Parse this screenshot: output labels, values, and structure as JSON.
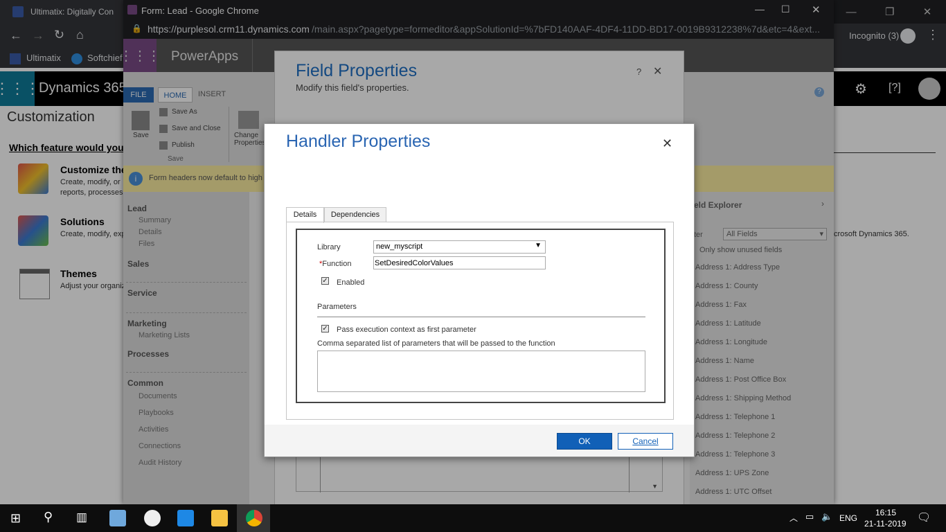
{
  "bg_browser": {
    "tab_title": "Ultimatix: Digitally Con",
    "bookmarks": [
      "Ultimatix",
      "Softchief"
    ],
    "incognito_label": "Incognito (3)"
  },
  "bg_dynamics": {
    "app_title": "Dynamics 365",
    "page_heading": "Customization",
    "which_feature": "Which feature would you",
    "items": [
      {
        "title": "Customize the",
        "desc1": "Create, modify, or",
        "desc2": "reports, processes,"
      },
      {
        "title": "Solutions",
        "desc1": "Create, modify, exp",
        "desc2": ""
      },
      {
        "title": "Themes",
        "desc1": "Adjust your organiz",
        "desc2": ""
      }
    ],
    "right_text": "crosoft Dynamics 365."
  },
  "popup": {
    "window_title": "Form: Lead - Google Chrome",
    "url_host": "https://purplesol.crm11.dynamics.com",
    "url_path": "/main.aspx?pagetype=formeditor&appSolutionId=%7bFD140AAF-4DF4-11DD-BD17-0019B9312238%7d&etc=4&ext...",
    "app_name": "PowerApps",
    "ribbon_tabs": [
      "FILE",
      "HOME",
      "INSERT"
    ],
    "ribbon": {
      "save": "Save",
      "save_as": "Save As",
      "save_close": "Save and Close",
      "publish": "Publish",
      "group_save": "Save",
      "change_props": "Change Properties"
    },
    "info_bar": "Form headers now default to high",
    "nav": {
      "lead": "Lead",
      "lead_items": [
        "Summary",
        "Details",
        "Files"
      ],
      "sections": [
        "Sales",
        "Service",
        "Marketing",
        "Processes",
        "Common"
      ],
      "marketing_items": [
        "Marketing Lists"
      ],
      "common_items": [
        "Documents",
        "Playbooks",
        "Activities",
        "Connections",
        "Audit History"
      ]
    },
    "field_explorer": {
      "title": "eld Explorer",
      "filter_label": "ter",
      "filter_value": "All Fields",
      "only_unused": "Only show unused fields",
      "fields": [
        "Address 1: Address Type",
        "Address 1: County",
        "Address 1: Fax",
        "Address 1: Latitude",
        "Address 1: Longitude",
        "Address 1: Name",
        "Address 1: Post Office Box",
        "Address 1: Shipping Method",
        "Address 1: Telephone 1",
        "Address 1: Telephone 2",
        "Address 1: Telephone 3",
        "Address 1: UPS Zone",
        "Address 1: UTC Offset"
      ]
    }
  },
  "field_properties": {
    "title": "Field Properties",
    "subtitle": "Modify this field's properties."
  },
  "handler": {
    "title": "Handler Properties",
    "tabs": [
      "Details",
      "Dependencies"
    ],
    "library_label": "Library",
    "library_value": "new_myscript",
    "function_label": "Function",
    "function_value": "SetDesiredColorValues",
    "enabled_label": "Enabled",
    "parameters_heading": "Parameters",
    "pass_context_label": "Pass execution context as first parameter",
    "comma_label": "Comma separated list of parameters that will be passed to the function",
    "params_value": "",
    "ok": "OK",
    "cancel": "Cancel"
  },
  "taskbar": {
    "language": "ENG",
    "time": "16:15",
    "date": "21-11-2019"
  }
}
